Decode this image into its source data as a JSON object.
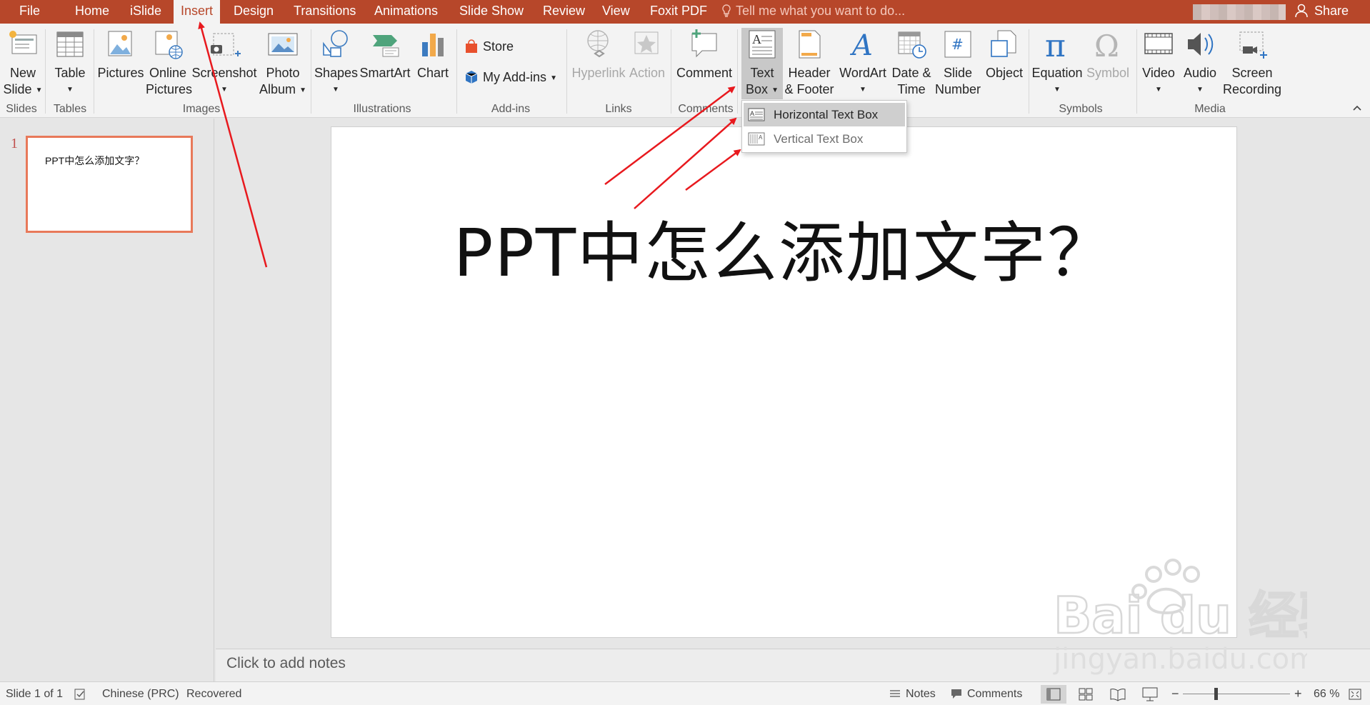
{
  "tabs": [
    "File",
    "Home",
    "iSlide",
    "Insert",
    "Design",
    "Transitions",
    "Animations",
    "Slide Show",
    "Review",
    "View",
    "Foxit PDF"
  ],
  "active_tab": "Insert",
  "tell_me": "Tell me what you want to do...",
  "share": "Share",
  "ribbon": {
    "new_slide": [
      "New",
      "Slide"
    ],
    "table": "Table",
    "pictures": "Pictures",
    "online_pictures": [
      "Online",
      "Pictures"
    ],
    "screenshot": "Screenshot",
    "photo_album": [
      "Photo",
      "Album"
    ],
    "shapes": "Shapes",
    "smartart": "SmartArt",
    "chart": "Chart",
    "store": "Store",
    "my_addins": "My Add-ins",
    "hyperlink": "Hyperlink",
    "action": "Action",
    "comment": "Comment",
    "text_box": [
      "Text",
      "Box"
    ],
    "header_footer": [
      "Header",
      "& Footer"
    ],
    "wordart": "WordArt",
    "date_time": [
      "Date &",
      "Time"
    ],
    "slide_number": [
      "Slide",
      "Number"
    ],
    "object": "Object",
    "equation": "Equation",
    "symbol": "Symbol",
    "video": "Video",
    "audio": "Audio",
    "screen_recording": [
      "Screen",
      "Recording"
    ]
  },
  "groups": [
    "Slides",
    "Tables",
    "Images",
    "Illustrations",
    "Add-ins",
    "Links",
    "Comments",
    "Symbols",
    "Media"
  ],
  "textbox_menu": [
    {
      "label": "Horizontal Text Box",
      "highlighted": true
    },
    {
      "label": "Vertical Text Box",
      "highlighted": false
    }
  ],
  "thumbnail": {
    "number": "1",
    "text": "PPT中怎么添加文字？"
  },
  "slide_title": "PPT中怎么添加文字？",
  "notes_placeholder": "Click to add notes",
  "status": {
    "slide": "Slide 1 of 1",
    "language": "Chinese (PRC)",
    "recovered": "Recovered",
    "notes": "Notes",
    "comments": "Comments",
    "zoom": "66 %"
  },
  "watermark": {
    "logo": "Bai du 经验",
    "url": "jingyan.baidu.com"
  },
  "colors": {
    "accent": "#b7472a",
    "annotation_arrow": "#e8191e"
  }
}
